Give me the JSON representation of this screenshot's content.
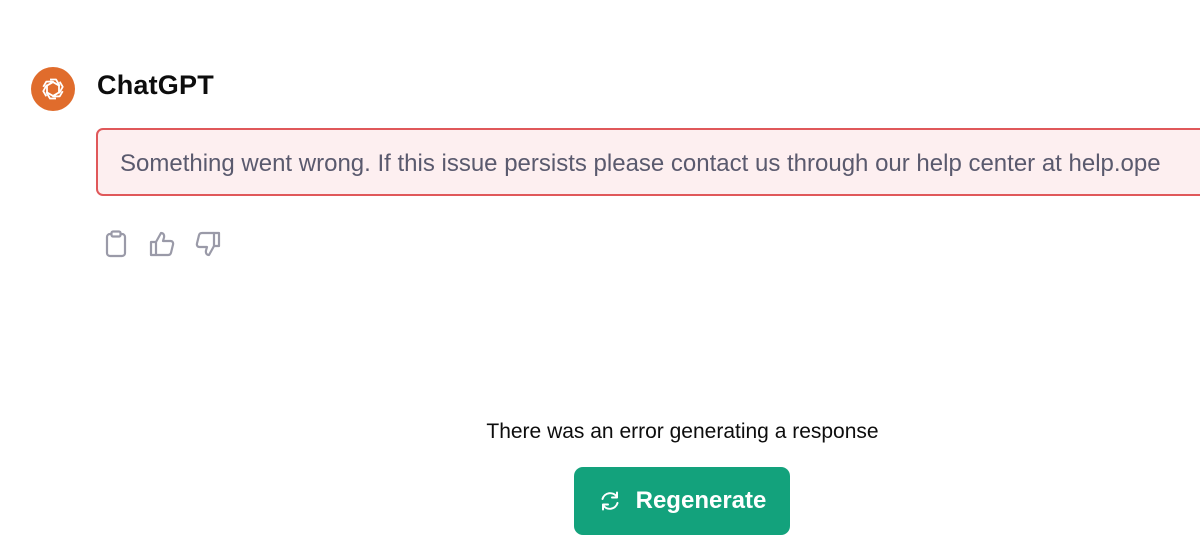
{
  "message": {
    "author": "ChatGPT",
    "avatar_icon": "openai-logo-icon",
    "avatar_color": "#e06c2c",
    "error_text": "Something went wrong. If this issue persists please contact us through our help center at help.ope"
  },
  "actions": [
    {
      "name": "copy",
      "icon": "clipboard-icon"
    },
    {
      "name": "thumbs-up",
      "icon": "thumbs-up-icon"
    },
    {
      "name": "thumbs-down",
      "icon": "thumbs-down-icon"
    }
  ],
  "footer": {
    "status_text": "There was an error generating a response",
    "regenerate_label": "Regenerate",
    "regenerate_icon": "refresh-icon",
    "button_color": "#13a27c"
  },
  "colors": {
    "error_border": "#e0585a",
    "error_background": "#fdeff0",
    "error_text": "#5a5a6e",
    "icon_gray": "#9a9aa8"
  }
}
